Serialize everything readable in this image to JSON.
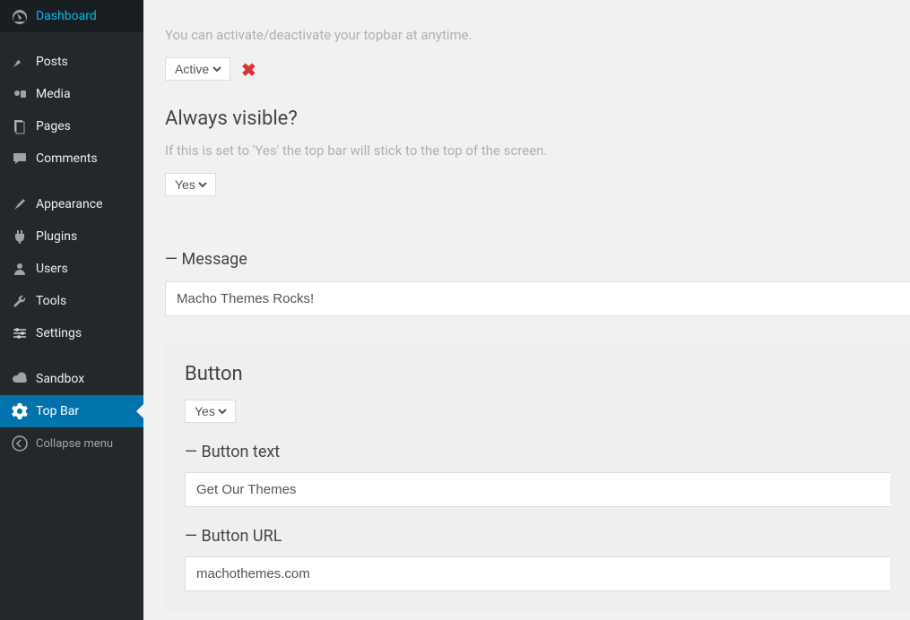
{
  "sidebar": {
    "items": [
      {
        "label": "Dashboard"
      },
      {
        "label": "Posts"
      },
      {
        "label": "Media"
      },
      {
        "label": "Pages"
      },
      {
        "label": "Comments"
      },
      {
        "label": "Appearance"
      },
      {
        "label": "Plugins"
      },
      {
        "label": "Users"
      },
      {
        "label": "Tools"
      },
      {
        "label": "Settings"
      },
      {
        "label": "Sandbox"
      },
      {
        "label": "Top Bar"
      }
    ],
    "collapse": "Collapse menu"
  },
  "content": {
    "activate_hint": "You can activate/deactivate your topbar at anytime.",
    "status_select": "Active",
    "always_visible_title": "Always visible?",
    "always_visible_hint": "If this is set to 'Yes' the top bar will stick to the top of the screen.",
    "always_visible_select": "Yes",
    "message_label": "— Message",
    "message_value": "Macho Themes Rocks!",
    "button_title": "Button",
    "button_select": "Yes",
    "button_text_label": "— Button text",
    "button_text_value": "Get Our Themes",
    "button_url_label": "— Button URL",
    "button_url_value": "machothemes.com"
  }
}
